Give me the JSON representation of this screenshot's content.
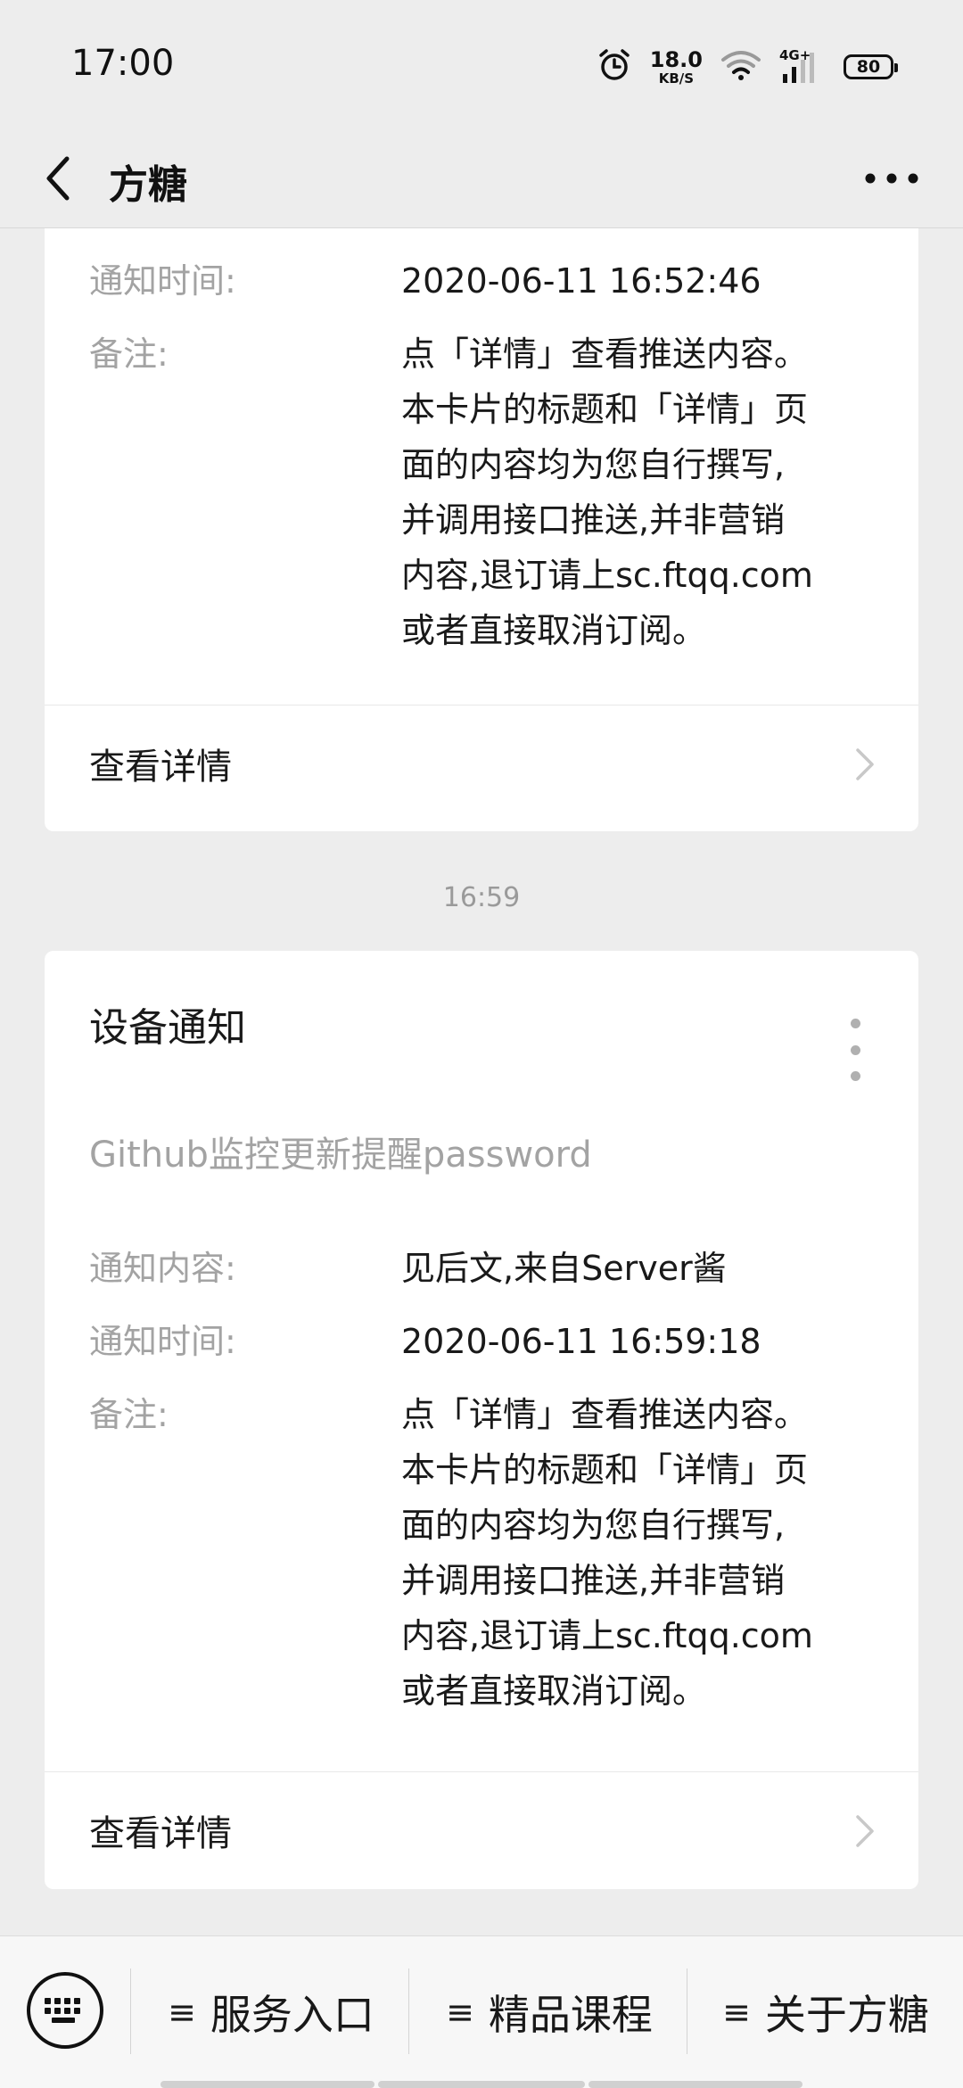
{
  "status_bar": {
    "time": "17:00",
    "net_speed_value": "18.0",
    "net_speed_unit": "KB/S",
    "network_type": "4G+",
    "battery": "80"
  },
  "header": {
    "title": "方糖",
    "back_icon": "chevron-left-icon",
    "more_icon": "more-horizontal-icon"
  },
  "messages": [
    {
      "fields": [
        {
          "label": "通知时间:",
          "value": "2020-06-11 16:52:46"
        },
        {
          "label": "备注:",
          "value": "点「详情」查看推送内容。\n本卡片的标题和「详情」页\n面的内容均为您自行撰写,\n并调用接口推送,并非营销\n内容,退订请上sc.ftqq.com\n或者直接取消订阅。"
        }
      ],
      "detail_label": "查看详情"
    },
    {
      "time": "16:59",
      "title": "设备通知",
      "subtitle": "Github监控更新提醒password",
      "fields": [
        {
          "label": "通知内容:",
          "value": "见后文,来自Server酱"
        },
        {
          "label": "通知时间:",
          "value": "2020-06-11 16:59:18"
        },
        {
          "label": "备注:",
          "value": "点「详情」查看推送内容。\n本卡片的标题和「详情」页\n面的内容均为您自行撰写,\n并调用接口推送,并非营销\n内容,退订请上sc.ftqq.com\n或者直接取消订阅。"
        }
      ],
      "detail_label": "查看详情"
    }
  ],
  "bottom_menu": {
    "keyboard_icon": "keyboard-icon",
    "items": [
      {
        "icon": "≡",
        "label": "服务入口"
      },
      {
        "icon": "≡",
        "label": "精品课程"
      },
      {
        "icon": "≡",
        "label": "关于方糖"
      }
    ]
  },
  "colors": {
    "background": "#ededed",
    "card": "#ffffff",
    "label": "#a3a3a3",
    "text": "#191919"
  }
}
